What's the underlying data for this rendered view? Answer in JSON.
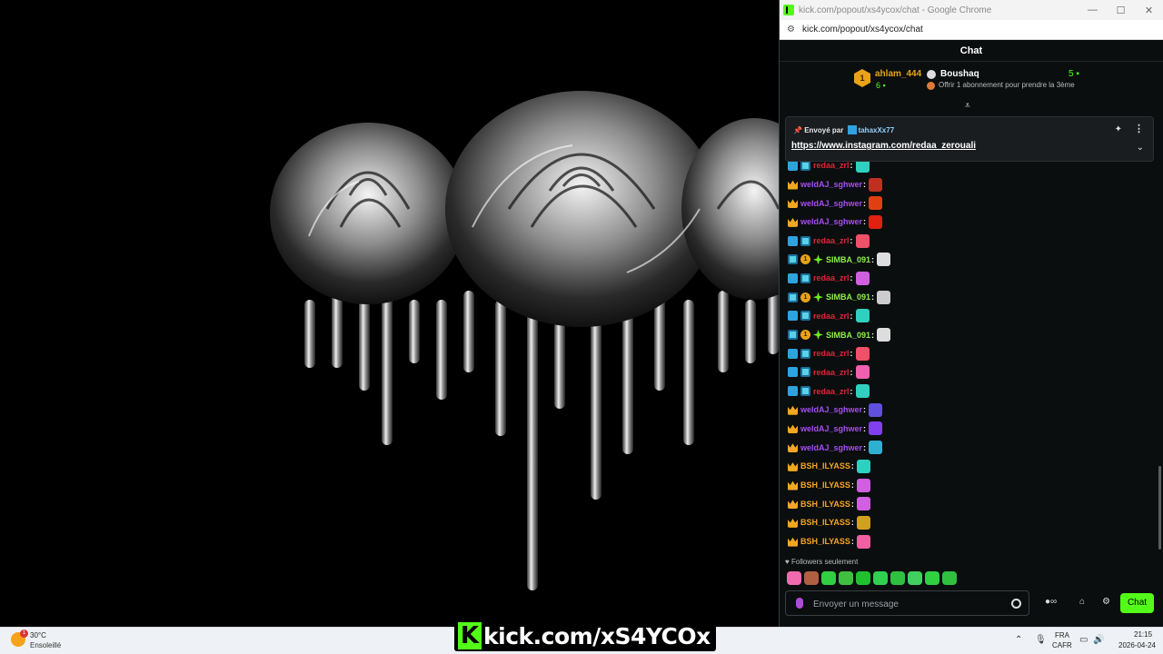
{
  "window": {
    "title": "kick.com/popout/xs4ycox/chat - Google Chrome",
    "url": "kick.com/popout/xs4ycox/chat"
  },
  "chat": {
    "header": "Chat",
    "leaderboard": {
      "first": {
        "rank": "1",
        "name": "ahlam_444",
        "count": "6"
      },
      "second": {
        "name": "Boushaq",
        "count": "5",
        "subtext": "Offrir 1 abonnement pour prendre la 3ème"
      }
    },
    "pinned": {
      "sent_by_label": "Envoyé par",
      "user": "tahaxXx77",
      "link": "https://www.instagram.com/redaa_zerouali"
    },
    "messages": [
      {
        "user": "redaa_zrl",
        "color": "#e0243a",
        "badges": [
          "mod",
          "sub"
        ],
        "emote": "#2fd0c0"
      },
      {
        "user": "weldAJ_sghwer",
        "color": "#a44ef0",
        "badges": [
          "vip"
        ],
        "emote": "#c03020"
      },
      {
        "user": "weldAJ_sghwer",
        "color": "#a44ef0",
        "badges": [
          "vip"
        ],
        "emote": "#e04010"
      },
      {
        "user": "weldAJ_sghwer",
        "color": "#a44ef0",
        "badges": [
          "vip"
        ],
        "emote": "#e02010"
      },
      {
        "user": "redaa_zrl",
        "color": "#e0243a",
        "badges": [
          "mod",
          "sub"
        ],
        "emote": "#f0506a"
      },
      {
        "user": "SIMBA_091",
        "color": "#8ef04a",
        "badges": [
          "sub",
          "gift",
          "star"
        ],
        "emote": "#dddddd"
      },
      {
        "user": "redaa_zrl",
        "color": "#e0243a",
        "badges": [
          "mod",
          "sub"
        ],
        "emote": "#d060e0"
      },
      {
        "user": "SIMBA_091",
        "color": "#8ef04a",
        "badges": [
          "sub",
          "gift",
          "star"
        ],
        "emote": "#cccccc"
      },
      {
        "user": "redaa_zrl",
        "color": "#e0243a",
        "badges": [
          "mod",
          "sub"
        ],
        "emote": "#2fd0c0"
      },
      {
        "user": "SIMBA_091",
        "color": "#8ef04a",
        "badges": [
          "sub",
          "gift",
          "star"
        ],
        "emote": "#dddddd"
      },
      {
        "user": "redaa_zrl",
        "color": "#e0243a",
        "badges": [
          "mod",
          "sub"
        ],
        "emote": "#f0506a"
      },
      {
        "user": "redaa_zrl",
        "color": "#e0243a",
        "badges": [
          "mod",
          "sub"
        ],
        "emote": "#f060b0"
      },
      {
        "user": "redaa_zrl",
        "color": "#e0243a",
        "badges": [
          "mod",
          "sub"
        ],
        "emote": "#2fd0c0"
      },
      {
        "user": "weldAJ_sghwer",
        "color": "#a44ef0",
        "badges": [
          "vip"
        ],
        "emote": "#6050e0"
      },
      {
        "user": "weldAJ_sghwer",
        "color": "#a44ef0",
        "badges": [
          "vip"
        ],
        "emote": "#8040f0"
      },
      {
        "user": "weldAJ_sghwer",
        "color": "#a44ef0",
        "badges": [
          "vip"
        ],
        "emote": "#30b0d0"
      },
      {
        "user": "BSH_ILYASS",
        "color": "#f5a623",
        "badges": [
          "vip"
        ],
        "emote": "#2fd0c0"
      },
      {
        "user": "BSH_ILYASS",
        "color": "#f5a623",
        "badges": [
          "vip"
        ],
        "emote": "#d060e0"
      },
      {
        "user": "BSH_ILYASS",
        "color": "#f5a623",
        "badges": [
          "vip"
        ],
        "emote": "#d060e0"
      },
      {
        "user": "BSH_ILYASS",
        "color": "#f5a623",
        "badges": [
          "vip"
        ],
        "emote": "#d0a020"
      },
      {
        "user": "BSH_ILYASS",
        "color": "#f5a623",
        "badges": [
          "vip"
        ],
        "emote": "#f060a0"
      }
    ],
    "followers_only": "Followers seulement",
    "emote_bar": [
      "#f06ab0",
      "#b06040",
      "#30d040",
      "#40c040",
      "#20c030",
      "#30d050",
      "#30c040",
      "#40d060",
      "#30d040",
      "#30c040"
    ],
    "input_placeholder": "Envoyer un message",
    "send_button": "Chat"
  },
  "taskbar": {
    "temp": "30°C",
    "condition": "Ensoleillé",
    "weather_badge": "1",
    "brand_overlay": "kick.com/xS4YCOx",
    "lang_top": "FRA",
    "lang_bottom": "CAFR",
    "time": "21:15",
    "date": "2026-04-24"
  },
  "colors": {
    "kick_green": "#53fc18",
    "panel_bg": "#0b0e0f"
  }
}
